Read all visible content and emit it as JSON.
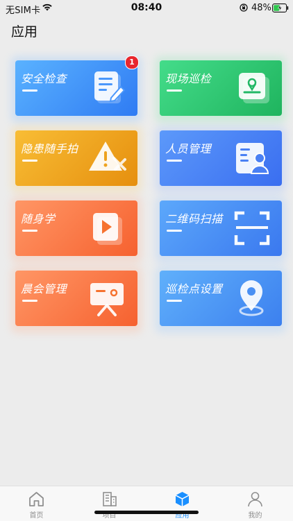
{
  "status_bar": {
    "carrier": "无SIM卡",
    "time": "08:40",
    "battery": "48%"
  },
  "page": {
    "title": "应用"
  },
  "tiles": [
    {
      "label": "安全检查",
      "icon": "document-pen-icon",
      "badge": "1",
      "colors": [
        "#4aa8ff",
        "#2f7bf3"
      ]
    },
    {
      "label": "现场巡检",
      "icon": "location-screen-icon",
      "colors": [
        "#36d47f",
        "#1fb45e"
      ]
    },
    {
      "label": "隐患随手拍",
      "icon": "warning-tools-icon",
      "colors": [
        "#f6b329",
        "#e68f0e"
      ]
    },
    {
      "label": "人员管理",
      "icon": "id-card-icon",
      "colors": [
        "#4f8df7",
        "#3a6ef0"
      ]
    },
    {
      "label": "随身学",
      "icon": "video-play-icon",
      "colors": [
        "#ff8a55",
        "#f6612f"
      ]
    },
    {
      "label": "二维码扫描",
      "icon": "qr-scan-icon",
      "colors": [
        "#4f9bf8",
        "#3a78ef"
      ]
    },
    {
      "label": "晨会管理",
      "icon": "presentation-board-icon",
      "colors": [
        "#ff8a55",
        "#f6612f"
      ]
    },
    {
      "label": "巡检点设置",
      "icon": "map-pin-icon",
      "colors": [
        "#52a3f8",
        "#3c80ef"
      ]
    }
  ],
  "tabbar": {
    "items": [
      {
        "label": "首页",
        "icon": "home-icon"
      },
      {
        "label": "项目",
        "icon": "building-icon"
      },
      {
        "label": "应用",
        "icon": "cube-icon",
        "active": true
      },
      {
        "label": "我的",
        "icon": "person-icon"
      }
    ]
  }
}
